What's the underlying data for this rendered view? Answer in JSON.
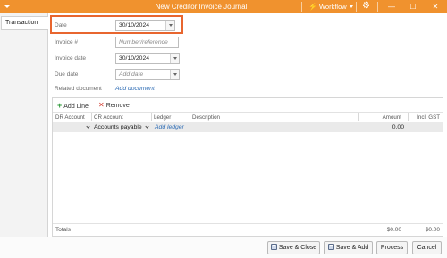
{
  "window": {
    "title": "New Creditor Invoice Journal",
    "workflow_label": "Workflow",
    "minimize_glyph": "—",
    "maximize_glyph": "☐",
    "close_glyph": "✕",
    "accent_color": "#f0922e"
  },
  "tabs": [
    {
      "label": "Transaction",
      "active": true
    }
  ],
  "form": {
    "date": {
      "label": "Date",
      "value": "30/10/2024"
    },
    "invoice_number": {
      "label": "Invoice #",
      "placeholder": "Number/reference"
    },
    "invoice_date": {
      "label": "Invoice date",
      "value": "30/10/2024"
    },
    "due_date": {
      "label": "Due date",
      "placeholder": "Add date"
    },
    "related_document": {
      "label": "Related document",
      "link": "Add document"
    }
  },
  "grid": {
    "add_line_label": "Add Line",
    "remove_label": "Remove",
    "columns": [
      "DR Account",
      "CR Account",
      "Ledger",
      "Description",
      "Amount",
      "Incl. GST"
    ],
    "rows": [
      {
        "cr_account": "Accounts payable",
        "ledger_link": "Add ledger",
        "amount": "0.00"
      }
    ],
    "totals": {
      "label": "Totals",
      "amount": "$0.00",
      "incl_gst": "$0.00"
    }
  },
  "buttons": {
    "save_close": "Save & Close",
    "save_add": "Save & Add",
    "process": "Process",
    "cancel": "Cancel"
  },
  "icons": [
    "menu-icon",
    "workflow-icon",
    "gear-icon",
    "minimize-icon",
    "maximize-icon",
    "close-icon",
    "plus-icon",
    "remove-x-icon",
    "chevron-down-icon",
    "save-icon"
  ]
}
